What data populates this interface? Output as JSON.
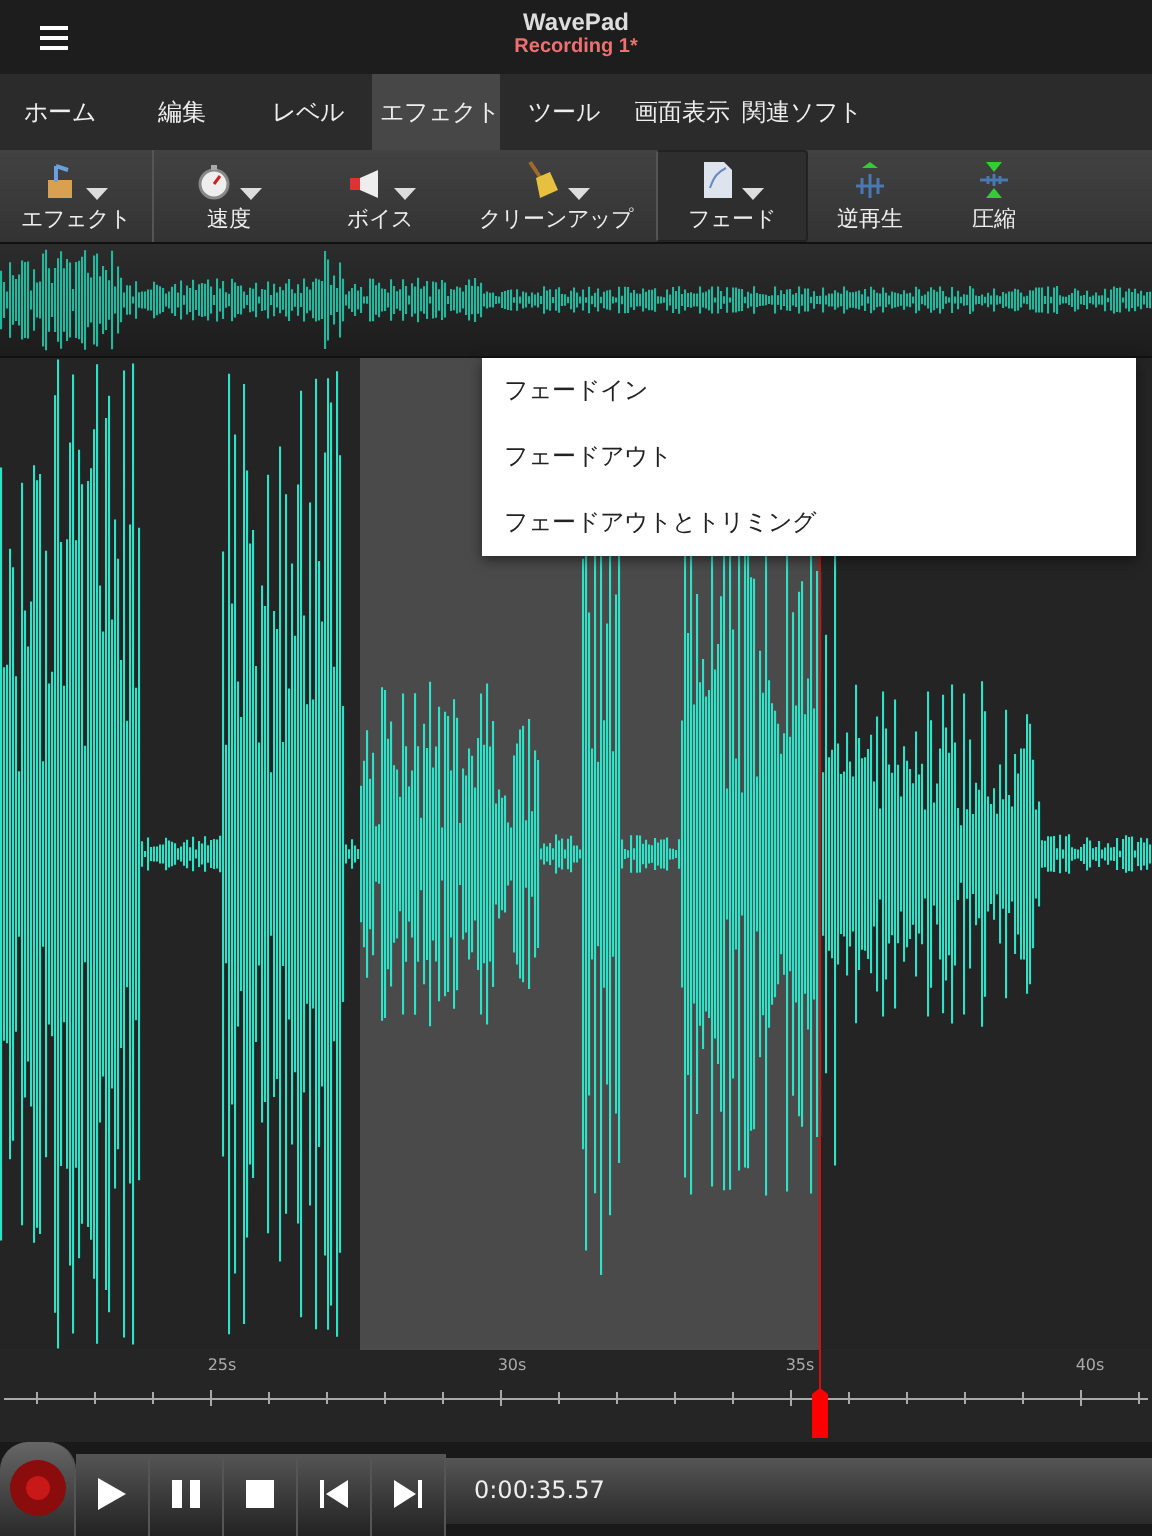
{
  "app": {
    "title": "WavePad",
    "document": "Recording 1*"
  },
  "tabs": [
    {
      "label": "ホーム",
      "selected": false
    },
    {
      "label": "編集",
      "selected": false
    },
    {
      "label": "レベル",
      "selected": false
    },
    {
      "label": "エフェクト",
      "selected": true
    },
    {
      "label": "ツール",
      "selected": false
    },
    {
      "label": "画面表示",
      "selected": false
    },
    {
      "label": "関連ソフト",
      "selected": false
    }
  ],
  "toolbar": [
    {
      "label": "エフェクト",
      "kind": "effect",
      "dropdown": true,
      "selected": false
    },
    {
      "label": "速度",
      "kind": "speed",
      "dropdown": true,
      "selected": false
    },
    {
      "label": "ボイス",
      "kind": "voice",
      "dropdown": true,
      "selected": false
    },
    {
      "label": "クリーンアップ",
      "kind": "cleanup",
      "dropdown": true,
      "selected": false
    },
    {
      "label": "フェード",
      "kind": "fade",
      "dropdown": true,
      "selected": true
    },
    {
      "label": "逆再生",
      "kind": "reverse",
      "dropdown": false,
      "selected": false
    },
    {
      "label": "圧縮",
      "kind": "compress",
      "dropdown": false,
      "selected": false
    }
  ],
  "menu": [
    "フェードイン",
    "フェードアウト",
    "フェードアウトとトリミング"
  ],
  "timeline": {
    "labels": [
      "25s",
      "30s",
      "35s",
      "40s"
    ]
  },
  "transport": {
    "time": "0:00:35.57"
  }
}
